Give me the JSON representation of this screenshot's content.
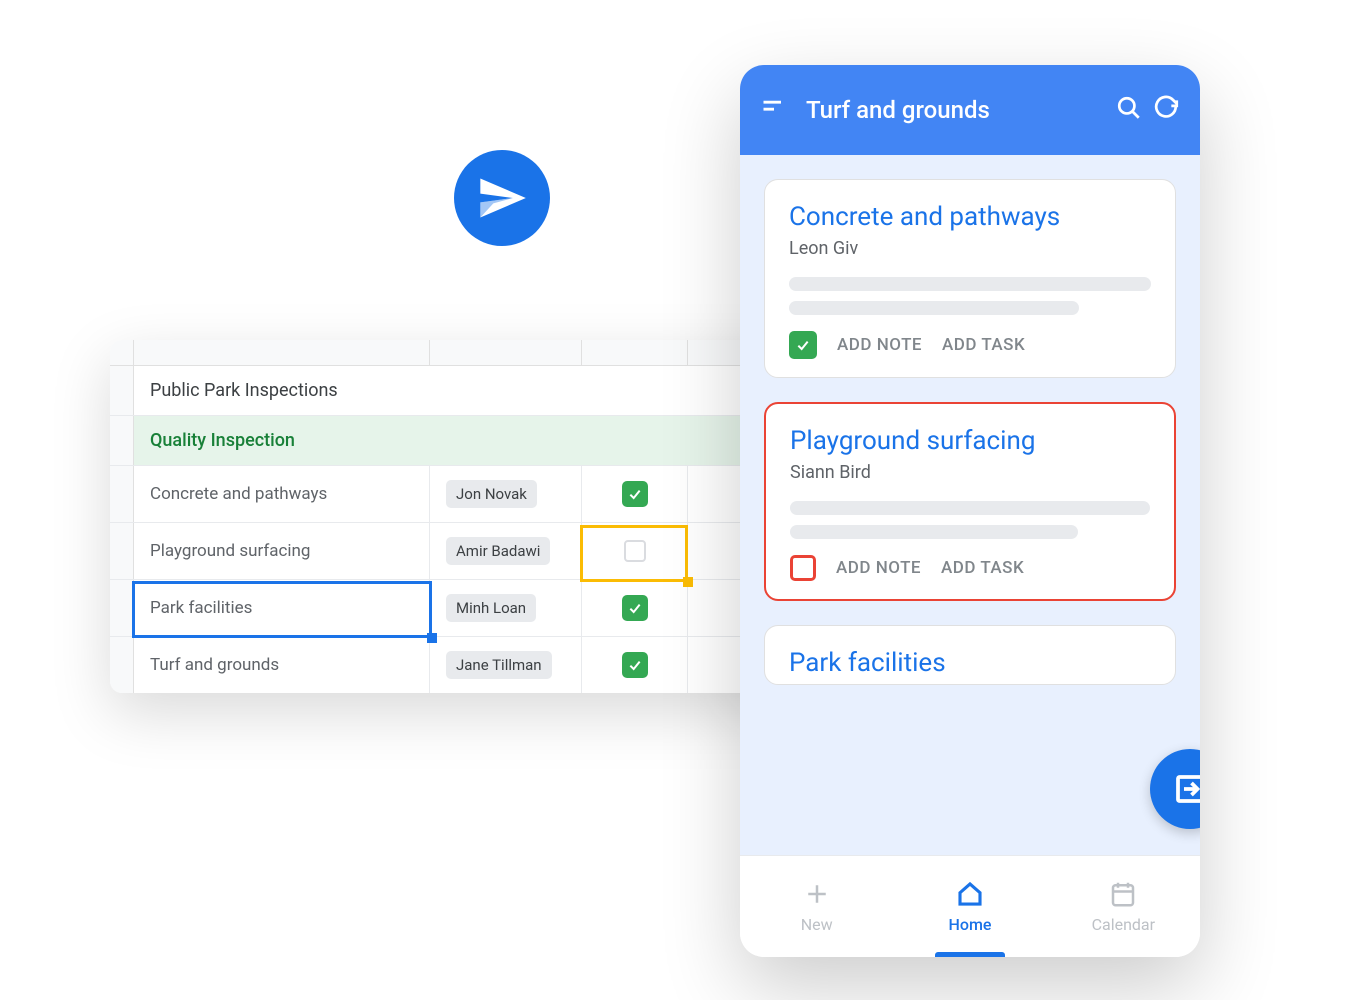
{
  "sheet": {
    "title": "Public Park Inspections",
    "section": "Quality Inspection",
    "rows": [
      {
        "task": "Concrete and pathways",
        "person": "Jon Novak",
        "checked": true
      },
      {
        "task": "Playground surfacing",
        "person": "Amir Badawi",
        "checked": false
      },
      {
        "task": "Park facilities",
        "person": "Minh Loan",
        "checked": true
      },
      {
        "task": "Turf and grounds",
        "person": "Jane Tillman",
        "checked": true
      }
    ]
  },
  "phone": {
    "header_title": "Turf and grounds",
    "cards": [
      {
        "title": "Concrete and pathways",
        "sub": "Leon Giv",
        "add_note": "ADD NOTE",
        "add_task": "ADD TASK"
      },
      {
        "title": "Playground surfacing",
        "sub": "Siann Bird",
        "add_note": "ADD NOTE",
        "add_task": "ADD TASK"
      },
      {
        "title": "Park facilities"
      }
    ],
    "nav": {
      "new": "New",
      "home": "Home",
      "calendar": "Calendar"
    }
  }
}
